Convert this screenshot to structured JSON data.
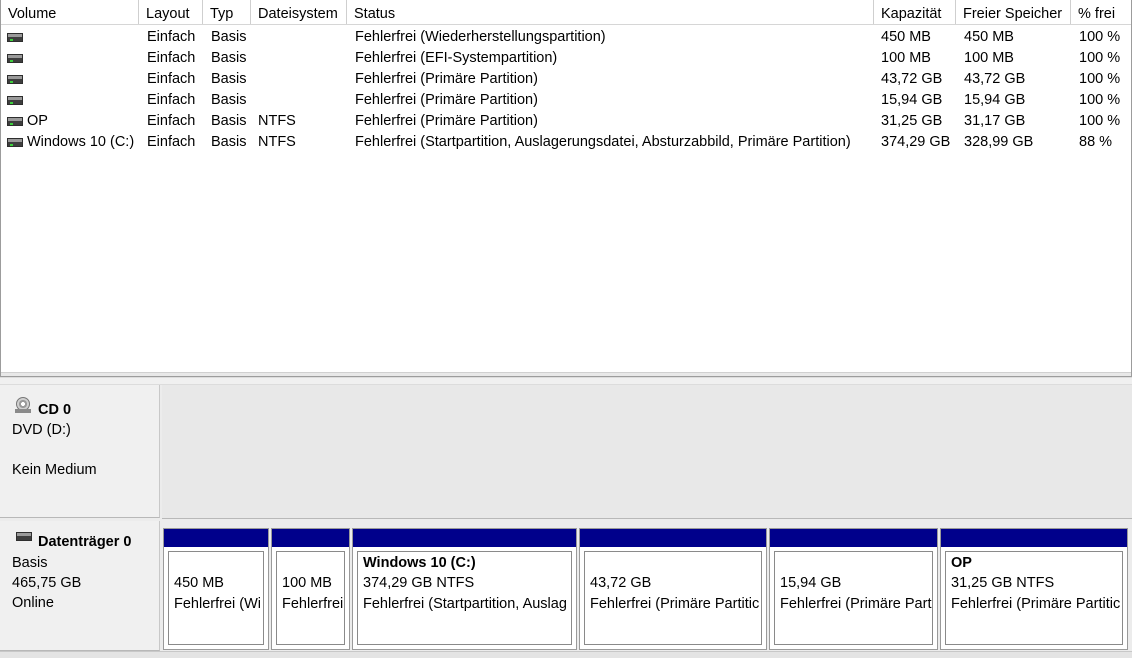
{
  "volume_list": {
    "columns": [
      "Volume",
      "Layout",
      "Typ",
      "Dateisystem",
      "Status",
      "Kapazität",
      "Freier Speicher",
      "% frei"
    ],
    "rows": [
      {
        "volume": "",
        "layout": "Einfach",
        "typ": "Basis",
        "fs": "",
        "status": "Fehlerfrei (Wiederherstellungspartition)",
        "capacity": "450 MB",
        "free": "450 MB",
        "pct": "100 %"
      },
      {
        "volume": "",
        "layout": "Einfach",
        "typ": "Basis",
        "fs": "",
        "status": "Fehlerfrei (EFI-Systempartition)",
        "capacity": "100 MB",
        "free": "100 MB",
        "pct": "100 %"
      },
      {
        "volume": "",
        "layout": "Einfach",
        "typ": "Basis",
        "fs": "",
        "status": "Fehlerfrei (Primäre Partition)",
        "capacity": "43,72 GB",
        "free": "43,72 GB",
        "pct": "100 %"
      },
      {
        "volume": "",
        "layout": "Einfach",
        "typ": "Basis",
        "fs": "",
        "status": "Fehlerfrei (Primäre Partition)",
        "capacity": "15,94 GB",
        "free": "15,94 GB",
        "pct": "100 %"
      },
      {
        "volume": "OP",
        "layout": "Einfach",
        "typ": "Basis",
        "fs": "NTFS",
        "status": "Fehlerfrei (Primäre Partition)",
        "capacity": "31,25 GB",
        "free": "31,17 GB",
        "pct": "100 %"
      },
      {
        "volume": "Windows 10 (C:)",
        "layout": "Einfach",
        "typ": "Basis",
        "fs": "NTFS",
        "status": "Fehlerfrei (Startpartition, Auslagerungsdatei, Absturzabbild, Primäre Partition)",
        "capacity": "374,29 GB",
        "free": "328,99 GB",
        "pct": "88 %"
      }
    ]
  },
  "cd": {
    "icon": "cd-drive-icon",
    "name": "CD 0",
    "drive": "DVD (D:)",
    "media": "Kein Medium"
  },
  "disk0": {
    "icon": "hard-disk-icon",
    "name": "Datenträger 0",
    "type": "Basis",
    "size": "465,75 GB",
    "state": "Online",
    "partitions": [
      {
        "title": "",
        "line1": "450 MB",
        "line2": "Fehlerfrei (Wi"
      },
      {
        "title": "",
        "line1": "100 MB",
        "line2": "Fehlerfrei"
      },
      {
        "title": "Windows 10  (C:)",
        "line1": "374,29 GB NTFS",
        "line2": "Fehlerfrei (Startpartition, Auslag"
      },
      {
        "title": "",
        "line1": "43,72 GB",
        "line2": "Fehlerfrei (Primäre Partitic"
      },
      {
        "title": "",
        "line1": "15,94 GB",
        "line2": "Fehlerfrei (Primäre Part"
      },
      {
        "title": "OP",
        "line1": "31,25 GB NTFS",
        "line2": "Fehlerfrei (Primäre Partitic"
      }
    ],
    "partition_bar_color": "#00008B"
  }
}
